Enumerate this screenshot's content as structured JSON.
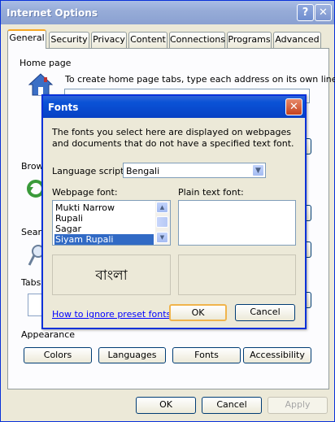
{
  "window": {
    "title": "Internet Options",
    "help": "?",
    "close": "✕"
  },
  "tabs": [
    "General",
    "Security",
    "Privacy",
    "Content",
    "Connections",
    "Programs",
    "Advanced"
  ],
  "general": {
    "home_page_label": "Home page",
    "home_page_text": "To create home page tabs, type each address on its own line.",
    "browsing_label": "Brows",
    "search_label": "Search",
    "tabs_label": "Tabs",
    "appearance_label": "Appearance",
    "colors": "Colors",
    "languages": "Languages",
    "fonts": "Fonts",
    "accessibility": "Accessibility"
  },
  "footer": {
    "ok": "OK",
    "cancel": "Cancel",
    "apply": "Apply"
  },
  "fonts_dialog": {
    "title": "Fonts",
    "close": "✕",
    "description": "The fonts you select here are displayed on webpages and documents that do not have a specified text font.",
    "language_label": "Language script:",
    "language_value": "Bengali",
    "webpage_font_label": "Webpage font:",
    "plain_text_font_label": "Plain text font:",
    "webpage_fonts": [
      "Mukti Narrow",
      "Rupali",
      "Sagar",
      "Siyam Rupali"
    ],
    "selected_font": "Siyam Rupali",
    "preview_text": "বাংলা",
    "ignore_link": "How to ignore preset fonts",
    "ok": "OK",
    "cancel": "Cancel"
  }
}
